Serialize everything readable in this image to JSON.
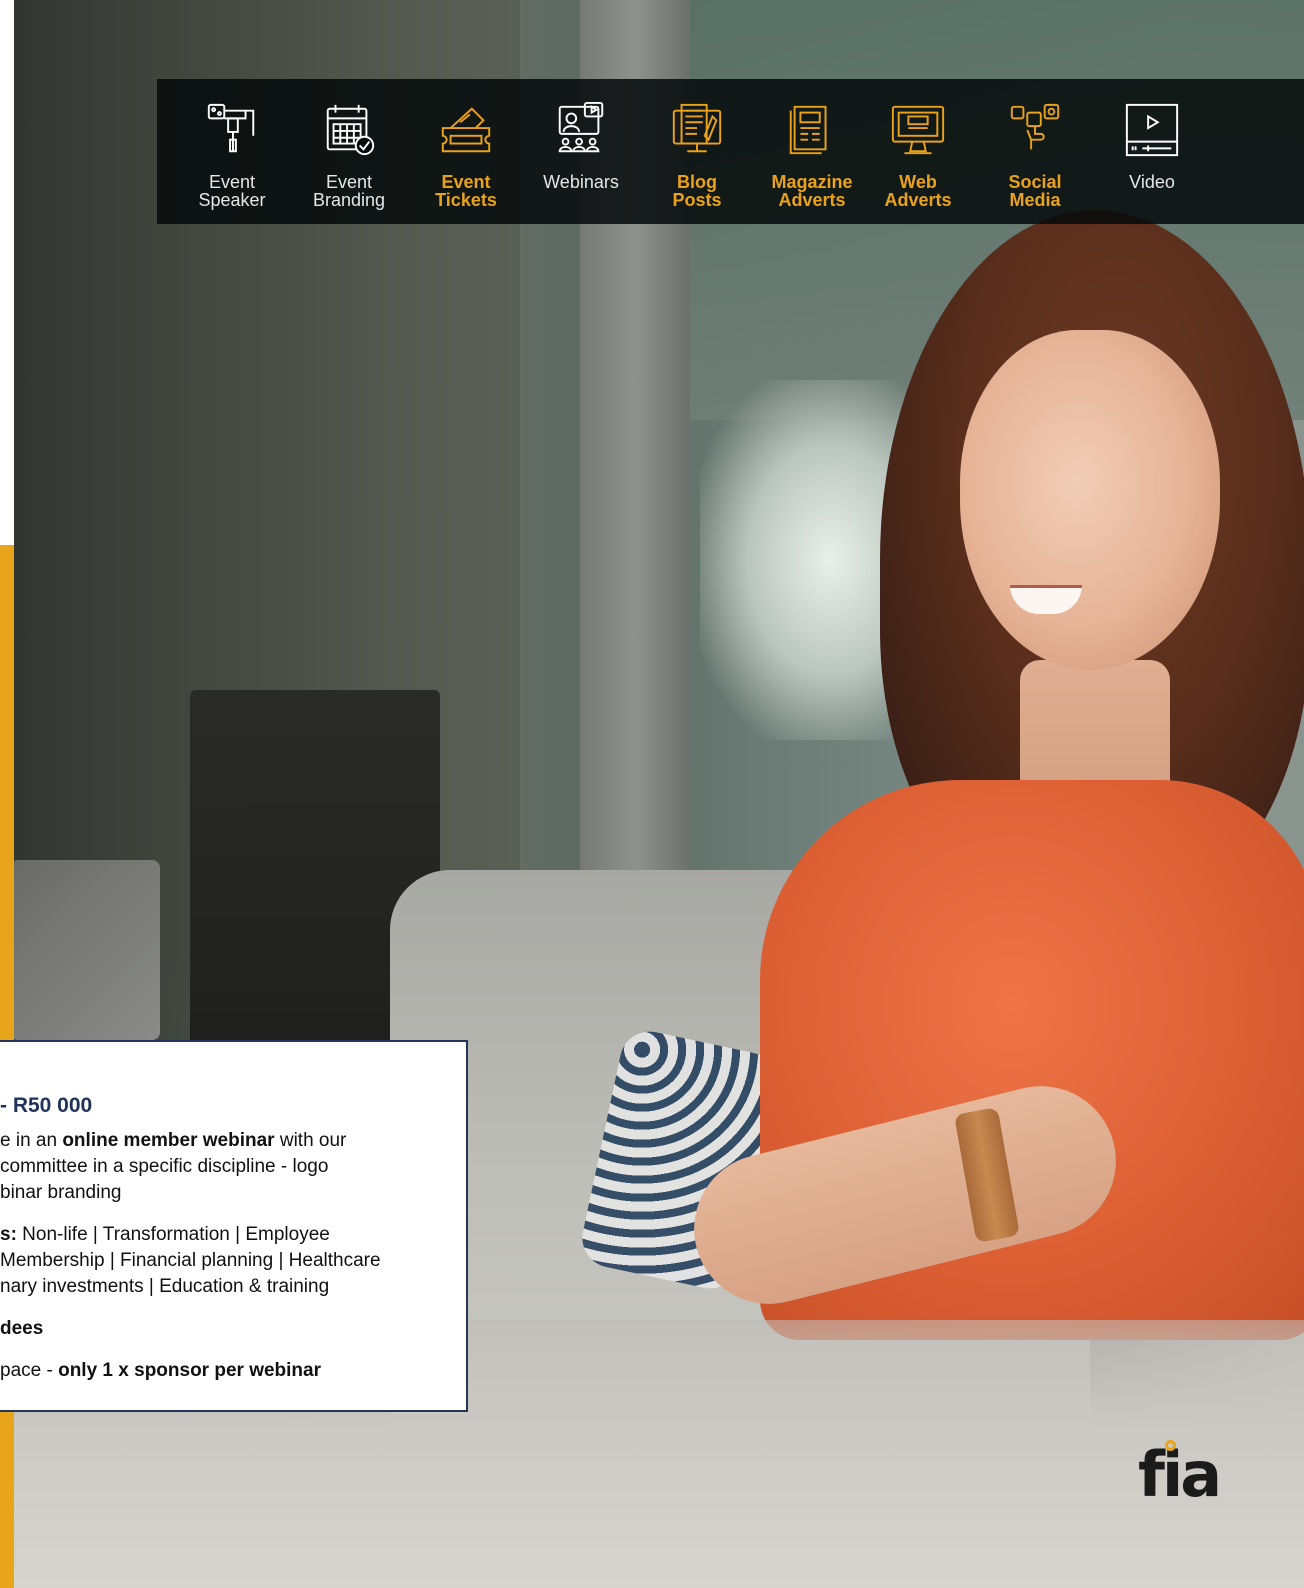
{
  "nav": {
    "items": [
      {
        "label": "Event\nSpeaker",
        "icon": "speaker-podium-icon",
        "color": "#ffffff"
      },
      {
        "label": "Event\nBranding",
        "icon": "calendar-check-icon",
        "color": "#ffffff"
      },
      {
        "label": "Event\nTickets",
        "icon": "ticket-icon",
        "color": "#eba21b"
      },
      {
        "label": "Webinars",
        "icon": "webinar-screen-icon",
        "color": "#ffffff"
      },
      {
        "label": "Blog\nPosts",
        "icon": "blog-post-icon",
        "color": "#eba21b"
      },
      {
        "label": "Magazine\nAdverts",
        "icon": "magazine-icon",
        "color": "#eba21b"
      },
      {
        "label": "Web\nAdverts",
        "icon": "monitor-icon",
        "color": "#eba21b"
      },
      {
        "label": "Social\nMedia",
        "icon": "social-media-icon",
        "color": "#eba21b"
      },
      {
        "label": "Video",
        "icon": "video-player-icon",
        "color": "#ffffff"
      }
    ]
  },
  "card": {
    "price": "- R50 000",
    "line1_pre": "e in an ",
    "line1_bold": "online member webinar",
    "line1_post": " with our",
    "line2": "committee in a specific discipline - logo",
    "line3": "binar branding",
    "line4_bold": "s:",
    "line4_post": " Non-life | Transformation | Employee",
    "line5": "Membership | Financial planning | Healthcare",
    "line6": "nary investments | Education & training",
    "line7_bold": "dees",
    "line8_pre": "pace - ",
    "line8_bold": "only 1 x sponsor per webinar"
  },
  "logo": {
    "text": "fia"
  },
  "colors": {
    "accent": "#e8a51b",
    "navy": "#24355c",
    "bar": "#050a0a"
  }
}
